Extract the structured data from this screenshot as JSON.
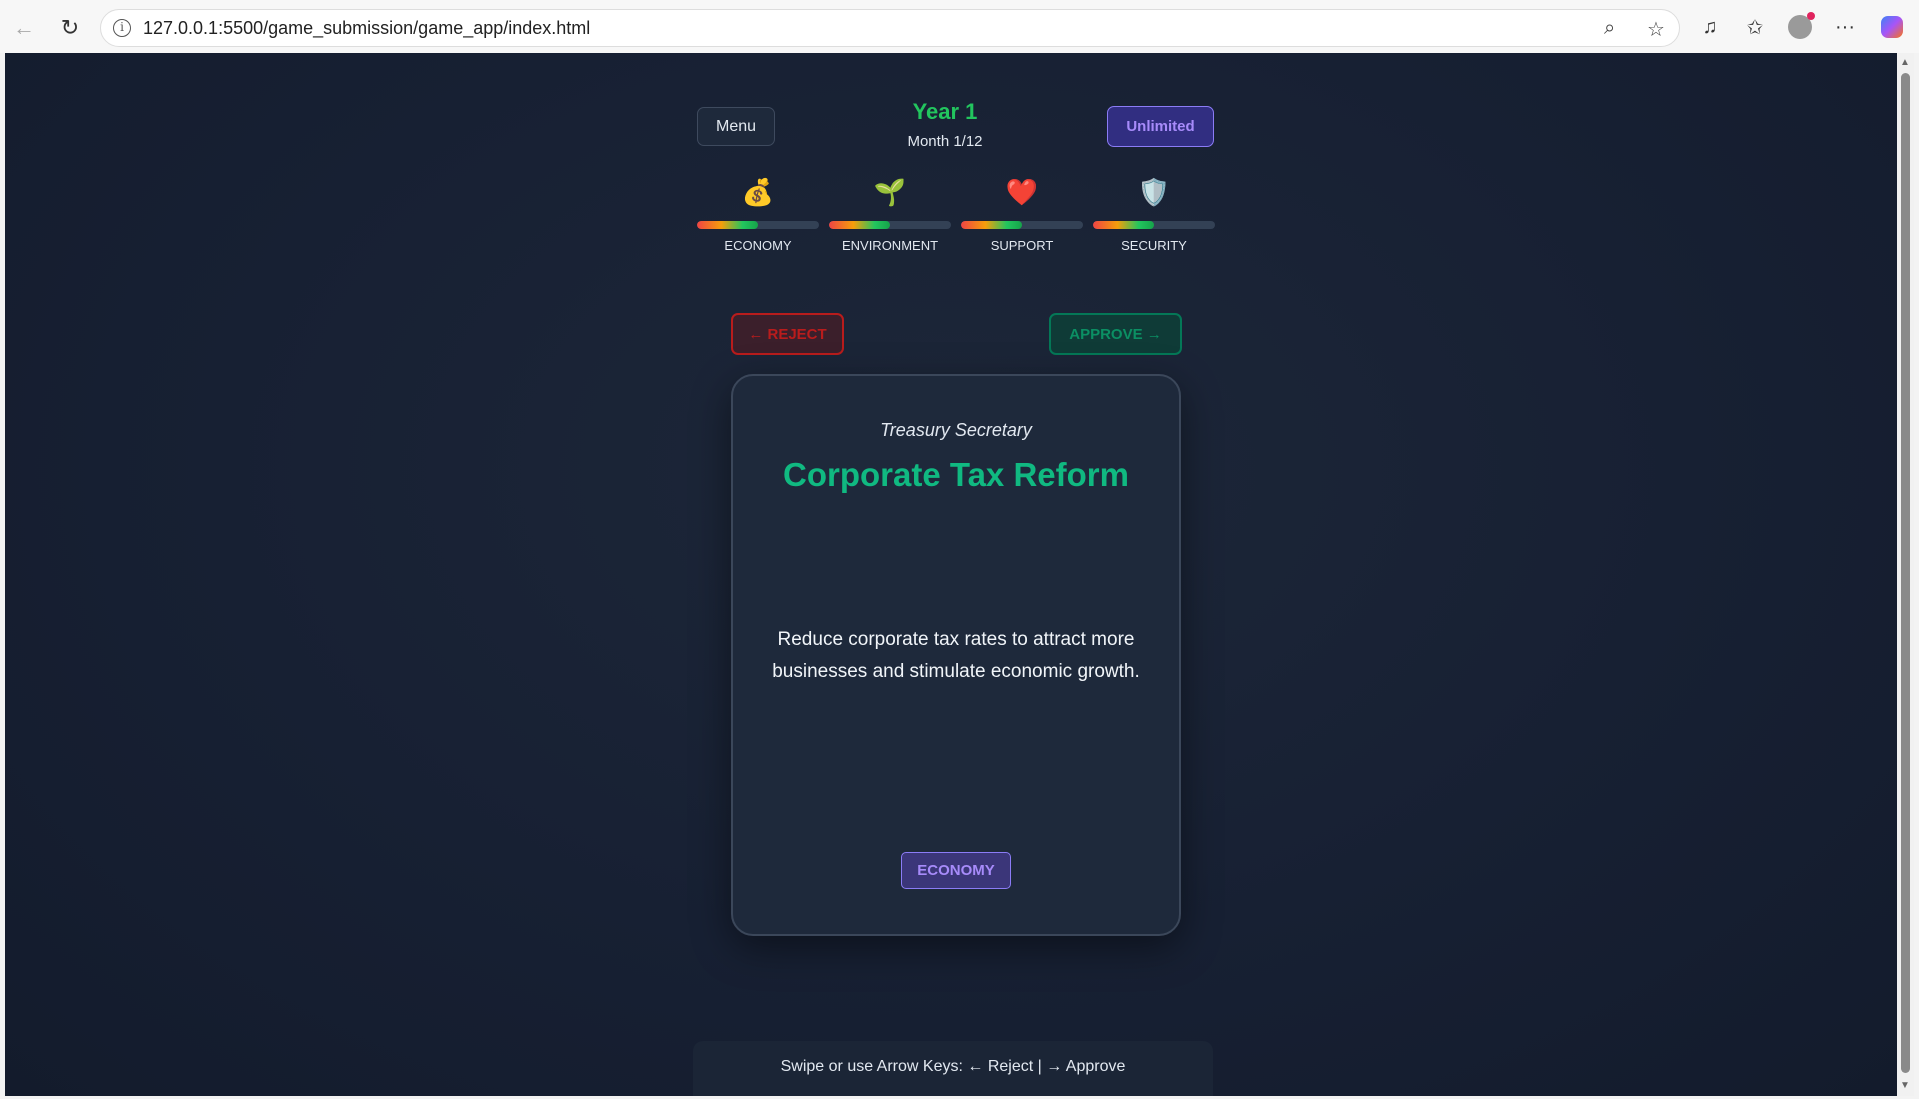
{
  "browser": {
    "url": "127.0.0.1:5500/game_submission/game_app/index.html"
  },
  "header": {
    "menu_label": "Menu",
    "year_label": "Year 1",
    "month_label": "Month 1/12",
    "mode_label": "Unlimited"
  },
  "stats": [
    {
      "label": "ECONOMY",
      "icon": "money-bag-icon",
      "glyph": "💰",
      "level": 0.5
    },
    {
      "label": "ENVIRONMENT",
      "icon": "seedling-icon",
      "glyph": "🌱",
      "level": 0.5
    },
    {
      "label": "SUPPORT",
      "icon": "heart-icon",
      "glyph": "❤️",
      "level": 0.5
    },
    {
      "label": "SECURITY",
      "icon": "shield-icon",
      "glyph": "🛡️",
      "level": 0.5
    }
  ],
  "actions": {
    "reject_label": "← REJECT",
    "approve_label": "APPROVE →"
  },
  "card": {
    "role": "Treasury Secretary",
    "title": "Corporate Tax Reform",
    "description": "Reduce corporate tax rates to attract more businesses and stimulate economic growth.",
    "tag": "ECONOMY"
  },
  "footer": {
    "hint": "Swipe or use Arrow Keys: ← Reject | → Approve"
  },
  "colors": {
    "background": "#172033",
    "accent_green": "#10b981",
    "accent_purple": "#a78bfa",
    "reject_red": "#b91c1c",
    "approve_green": "#047857"
  }
}
